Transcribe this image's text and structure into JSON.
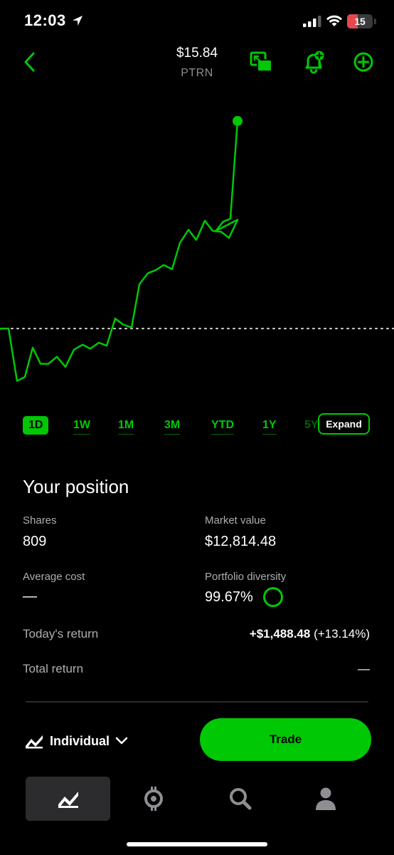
{
  "status_bar": {
    "time": "12:03",
    "battery_level": "15",
    "icons": [
      "location-arrow-icon",
      "cellular-signal-icon",
      "wifi-icon",
      "battery-icon"
    ]
  },
  "header": {
    "price": "$15.84",
    "symbol": "PTRN",
    "icons": [
      "back-chevron-icon",
      "picture-in-picture-icon",
      "add-alert-bell-icon",
      "add-circle-icon"
    ]
  },
  "colors": {
    "accent": "#00c805",
    "background": "#000000",
    "secondary_text": "#aeaeb2",
    "battery_low": "#e5484d"
  },
  "chart_data": {
    "type": "line",
    "description_series": "intraday price",
    "points": [
      100.0,
      100.0,
      48.0,
      52.0,
      81.0,
      65.0,
      65.0,
      72.0,
      62.0,
      79.0,
      84.0,
      80.0,
      86.0,
      83.0,
      110.0,
      104.0,
      101.0,
      144.0,
      155.0,
      158.0,
      163.0,
      159.0,
      185.0,
      198.0,
      188.0,
      207.0,
      197.0,
      196.0,
      190.0,
      208.0,
      197.0,
      206.0,
      209.0,
      306.0
    ],
    "reference_line": 100.0,
    "grid": false,
    "end_marker": true
  },
  "time_ranges": {
    "tabs": [
      "1D",
      "1W",
      "1M",
      "3M",
      "YTD",
      "1Y",
      "5Y"
    ],
    "active": "1D",
    "expand_label": "Expand"
  },
  "position": {
    "title": "Your position",
    "shares_label": "Shares",
    "shares_value": "809",
    "market_value_label": "Market value",
    "market_value": "$12,814.48",
    "avg_cost_label": "Average cost",
    "avg_cost_value": "—",
    "diversity_label": "Portfolio diversity",
    "diversity_value": "99.67%",
    "todays_return_label": "Today's return",
    "todays_return_amount": "+$1,488.48",
    "todays_return_pct": "(+13.14%)",
    "total_return_label": "Total return",
    "total_return_value": "—"
  },
  "account": {
    "label": "Individual",
    "trade_label": "Trade"
  },
  "bottom_nav": {
    "items": [
      "investing-chart-icon",
      "crypto-icon",
      "search-icon",
      "account-person-icon"
    ],
    "active": "investing-chart-icon"
  }
}
